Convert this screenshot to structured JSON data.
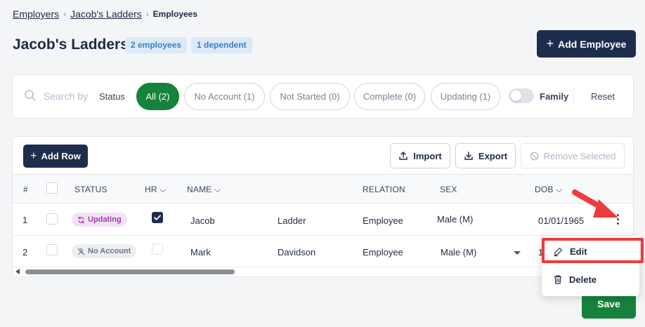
{
  "breadcrumb": {
    "items": [
      "Employers",
      "Jacob's Ladders"
    ],
    "current": "Employees",
    "separator": "›"
  },
  "header": {
    "title": "Jacob's Ladders",
    "badge_employees": "2 employees",
    "badge_dependents": "1 dependent",
    "add_employee_label": "Add Employee"
  },
  "filters": {
    "search_placeholder": "Search by",
    "status_label": "Status",
    "pills": [
      {
        "label": "All (2)",
        "active": true
      },
      {
        "label": "No Account (1)",
        "active": false
      },
      {
        "label": "Not Started (0)",
        "active": false
      },
      {
        "label": "Complete (0)",
        "active": false
      },
      {
        "label": "Updating (1)",
        "active": false
      }
    ],
    "family_label": "Family",
    "family_on": false,
    "reset_label": "Reset"
  },
  "toolbar": {
    "add_row_label": "Add Row",
    "import_label": "Import",
    "export_label": "Export",
    "remove_selected_label": "Remove Selected"
  },
  "table": {
    "headers": {
      "num": "#",
      "status": "STATUS",
      "hr": "HR",
      "name": "NAME",
      "relation": "RELATION",
      "sex": "SEX",
      "dob": "DOB"
    },
    "rows": [
      {
        "num": "1",
        "status": "Updating",
        "hr": true,
        "first": "Jacob",
        "last": "Ladder",
        "relation": "Employee",
        "sex": "Male (M)",
        "dob": "01/01/1965"
      },
      {
        "num": "2",
        "status": "No Account",
        "hr": false,
        "first": "Mark",
        "last": "Davidson",
        "relation": "Employee",
        "sex": "Male (M)",
        "dob": "1"
      }
    ]
  },
  "row_menu": {
    "edit_label": "Edit",
    "delete_label": "Delete"
  },
  "save_label": "Save",
  "colors": {
    "primary_navy": "#1f2d4d",
    "accent_green": "#15833b",
    "badge_blue_bg": "#dbe9f8",
    "updating_purple": "#9a3fb0",
    "annotation_red": "#ee3b3b"
  }
}
